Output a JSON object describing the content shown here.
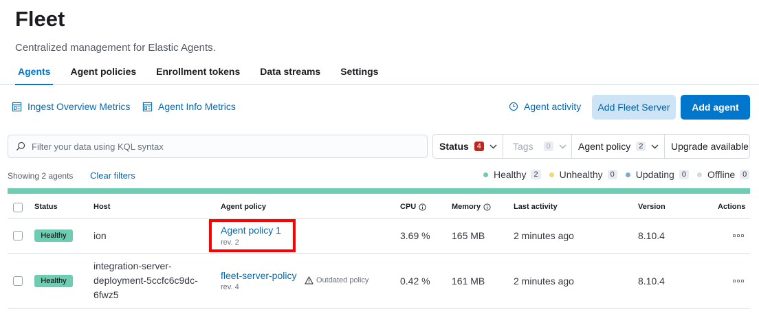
{
  "header": {
    "title": "Fleet",
    "subtitle": "Centralized management for Elastic Agents.",
    "tabs": [
      {
        "label": "Agents",
        "active": true
      },
      {
        "label": "Agent policies"
      },
      {
        "label": "Enrollment tokens"
      },
      {
        "label": "Data streams"
      },
      {
        "label": "Settings"
      }
    ]
  },
  "toolbar": {
    "ingest_metrics": "Ingest Overview Metrics",
    "agent_info_metrics": "Agent Info Metrics",
    "agent_activity": "Agent activity",
    "add_fleet_server": "Add Fleet Server",
    "add_agent": "Add agent"
  },
  "search": {
    "placeholder": "Filter your data using KQL syntax"
  },
  "filters": {
    "status": {
      "label": "Status",
      "count": "4"
    },
    "tags": {
      "label": "Tags",
      "count": "0"
    },
    "agent_policy": {
      "label": "Agent policy",
      "count": "2"
    },
    "upgrade": {
      "label": "Upgrade available"
    }
  },
  "summary": {
    "showing": "Showing 2 agents",
    "clear": "Clear filters"
  },
  "legend": [
    {
      "label": "Healthy",
      "count": "2",
      "color": "#6dccb1"
    },
    {
      "label": "Unhealthy",
      "count": "0",
      "color": "#f1d86f"
    },
    {
      "label": "Updating",
      "count": "0",
      "color": "#79aad9"
    },
    {
      "label": "Offline",
      "count": "0",
      "color": "#d3dae6"
    }
  ],
  "table": {
    "columns": {
      "status": "Status",
      "host": "Host",
      "agent_policy": "Agent policy",
      "cpu": "CPU",
      "memory": "Memory",
      "last_activity": "Last activity",
      "version": "Version",
      "actions": "Actions"
    },
    "rows": [
      {
        "status": "Healthy",
        "host": [
          "ion"
        ],
        "policy": "Agent policy 1",
        "rev": "rev. 2",
        "cpu": "3.69 %",
        "memory": "165 MB",
        "last_activity": "2 minutes ago",
        "version": "8.10.4"
      },
      {
        "status": "Healthy",
        "host": [
          "integration-server-",
          "deployment-5ccfc6c9dc-",
          "6fwz5"
        ],
        "policy": "fleet-server-policy",
        "rev": "rev. 4",
        "outdated": "Outdated policy",
        "cpu": "0.42 %",
        "memory": "161 MB",
        "last_activity": "2 minutes ago",
        "version": "8.10.4"
      }
    ]
  },
  "colors": {
    "accent": "#0077cc",
    "healthy": "#6dccb1",
    "highlight": "#ff0000"
  }
}
